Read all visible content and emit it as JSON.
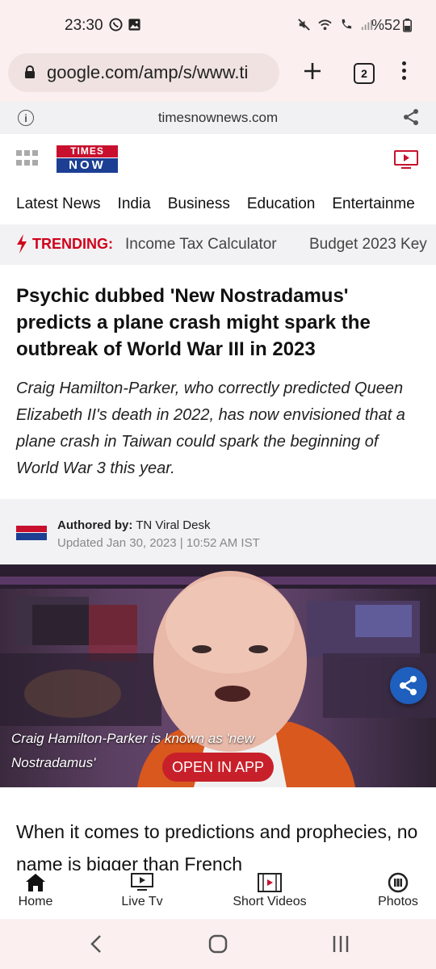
{
  "status_bar": {
    "time": "23:30",
    "battery": "%52"
  },
  "browser": {
    "url": "google.com/amp/s/www.ti",
    "tab_count": "2",
    "amp_domain": "timesnownews.com"
  },
  "site": {
    "logo_line1": "TIMES",
    "logo_line2": "NOW",
    "nav": [
      "Latest News",
      "India",
      "Business",
      "Education",
      "Entertainme"
    ],
    "trending_label": "TRENDING:",
    "trending": [
      "Income Tax Calculator",
      "Budget 2023 Key"
    ]
  },
  "article": {
    "headline": "Psychic dubbed 'New Nostradamus' predicts a plane crash might spark the outbreak of World War III in 2023",
    "summary": "Craig Hamilton-Parker, who correctly predicted Queen Elizabeth II's death in 2022, has now envisioned that a plane crash in Taiwan could spark the beginning of World War 3 this year.",
    "author_label": "Authored by:",
    "author": "TN Viral Desk",
    "updated": "Updated Jan 30, 2023 | 10:52 AM IST",
    "image_caption": "Craig Hamilton-Parker is known as 'new Nostradamus'",
    "open_in_app": "OPEN IN APP",
    "body_start": "When it comes to predictions and prophecies, no name is bigger than French"
  },
  "bottom_nav": [
    {
      "label": "Home",
      "icon": "home-icon"
    },
    {
      "label": "Live Tv",
      "icon": "tv-icon"
    },
    {
      "label": "Short Videos",
      "icon": "film-icon"
    },
    {
      "label": "Photos",
      "icon": "camera-icon"
    }
  ],
  "colors": {
    "brand_red": "#c8102e",
    "brand_blue": "#1c3f94",
    "trending_red": "#d0021b",
    "open_app_red": "#c8202a",
    "share_blue": "#1f5fbd"
  }
}
